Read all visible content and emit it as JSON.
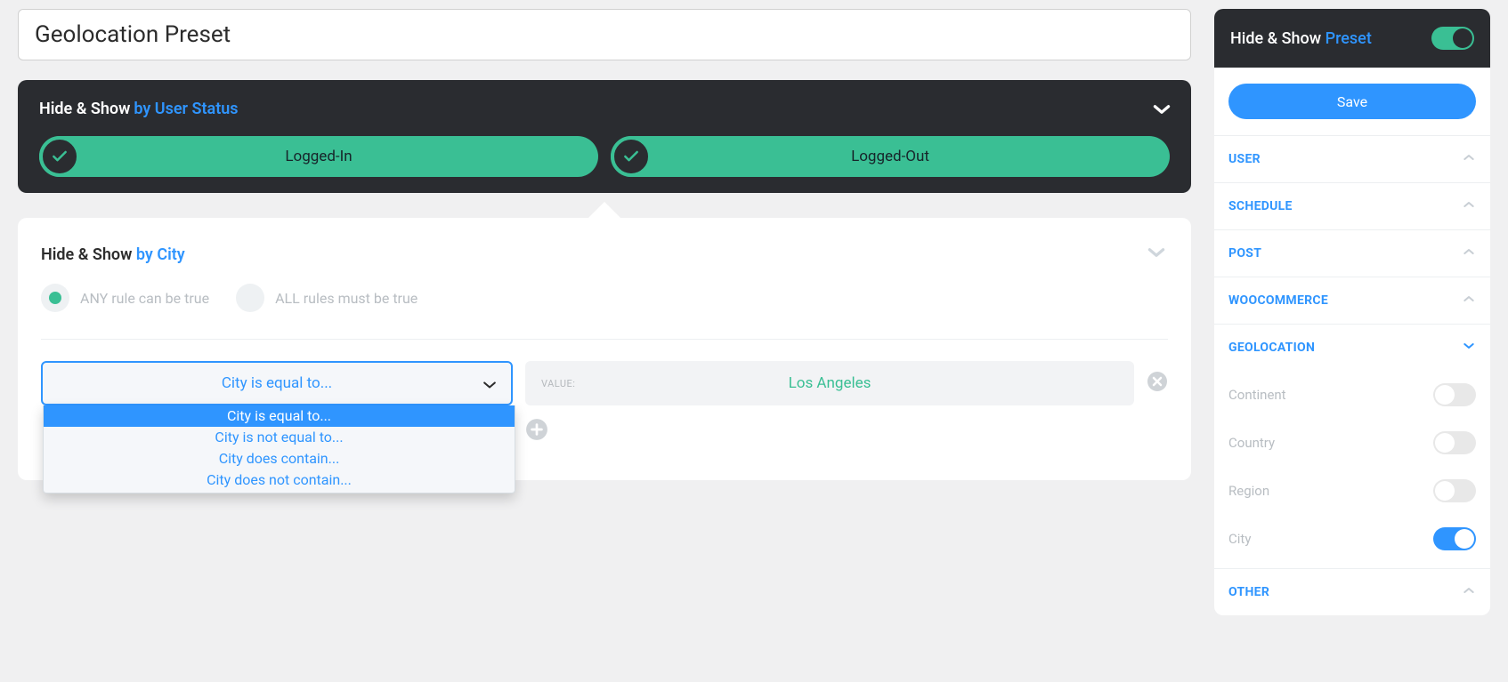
{
  "title_value": "Geolocation Preset",
  "user_status": {
    "label_prefix": "Hide & Show",
    "label_suffix": "by User Status",
    "pills": [
      "Logged-In",
      "Logged-Out"
    ]
  },
  "city_panel": {
    "label_prefix": "Hide & Show",
    "label_suffix": "by City",
    "rule_modes": {
      "any": "ANY rule can be true",
      "all": "ALL rules must be true"
    },
    "selected_condition": "City is equal to...",
    "select_options": [
      "City is equal to...",
      "City is not equal to...",
      "City does contain...",
      "City does not contain..."
    ],
    "value_label": "VALUE:",
    "value_text": "Los Angeles"
  },
  "sidebar": {
    "header_prefix": "Hide & Show",
    "header_suffix": "Preset",
    "save_label": "Save",
    "sections": {
      "user": "USER",
      "schedule": "SCHEDULE",
      "post": "POST",
      "woocommerce": "WOOCOMMERCE",
      "geolocation": "GEOLOCATION",
      "other": "OTHER"
    },
    "geo_items": {
      "continent": "Continent",
      "country": "Country",
      "region": "Region",
      "city": "City"
    }
  }
}
